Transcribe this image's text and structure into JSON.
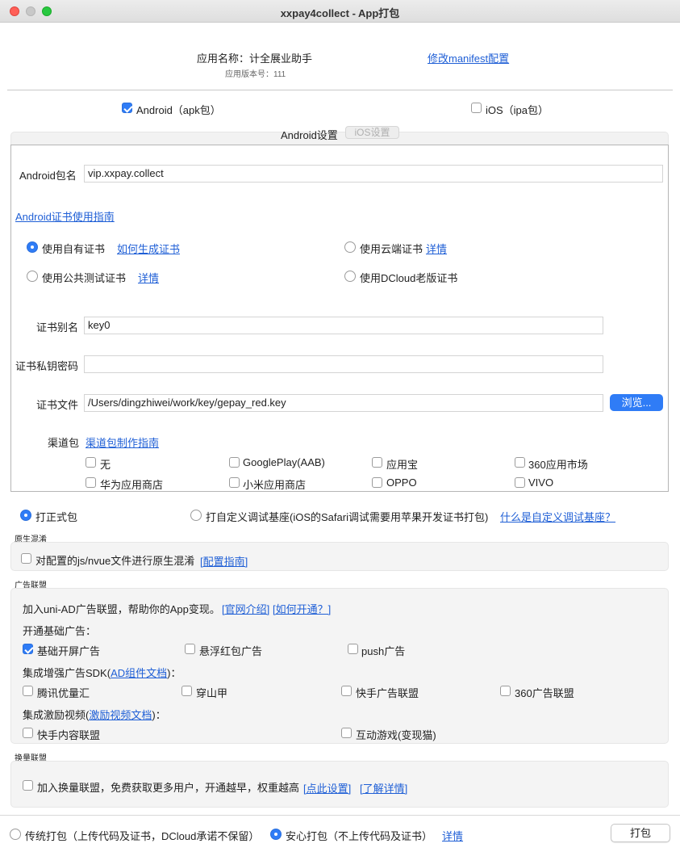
{
  "window": {
    "title": "xxpay4collect - App打包"
  },
  "header": {
    "app_name": "应用名称：计全展业助手",
    "app_version": "应用版本号：111",
    "edit_manifest": "修改manifest配置"
  },
  "platforms": {
    "android_label": "Android（apk包）",
    "android_checked": true,
    "ios_label": "iOS（ipa包）",
    "ios_checked": false
  },
  "tabs": [
    {
      "label": "Android设置",
      "active": true
    },
    {
      "label": "iOS设置",
      "active": false
    }
  ],
  "android": {
    "package_label": "Android包名",
    "package_value": "vip.xxpay.collect",
    "cert_guide": "Android证书使用指南",
    "cert_options": {
      "own": "使用自有证书",
      "own_link": "如何生成证书",
      "cloud": "使用云端证书",
      "cloud_link": "详情",
      "public_test": "使用公共测试证书",
      "public_link": "详情",
      "dcloud_old": "使用DCloud老版证书"
    },
    "alias_label": "证书别名",
    "alias_value": "key0",
    "password_label": "证书私钥密码",
    "password_value": "",
    "file_label": "证书文件",
    "file_value": "/Users/dingzhiwei/work/key/gepay_red.key",
    "browse": "浏览...",
    "channel_label": "渠道包",
    "channel_guide": "渠道包制作指南",
    "channels": [
      "无",
      "GooglePlay(AAB)",
      "应用宝",
      "360应用市场",
      "华为应用商店",
      "小米应用商店",
      "OPPO",
      "VIVO"
    ]
  },
  "build_type": {
    "formal": "打正式包",
    "custom": "打自定义调试基座(iOS的Safari调试需要用苹果开发证书打包)",
    "custom_link": "什么是自定义调试基座？"
  },
  "obfuscation": {
    "section": "原生混淆",
    "option": "对配置的js/nvue文件进行原生混淆",
    "link": "[配置指南]"
  },
  "ads": {
    "section": "广告联盟",
    "intro": "加入uni-AD广告联盟，帮助你的App变现。",
    "intro_link1": "[官网介绍]",
    "intro_link2": "[如何开通？]",
    "basic_title": "开通基础广告：",
    "basic": [
      "基础开屏广告",
      "悬浮红包广告",
      "push广告"
    ],
    "enhanced_title_prefix": "集成增强广告SDK(",
    "enhanced_link": "AD组件文档",
    "enhanced_title_suffix": ")：",
    "enhanced": [
      "腾讯优量汇",
      "穿山甲",
      "快手广告联盟",
      "360广告联盟"
    ],
    "reward_title_prefix": "集成激励视频(",
    "reward_link": "激励视频文档",
    "reward_title_suffix": ")：",
    "reward": [
      "快手内容联盟",
      "互动游戏(变现猫)"
    ]
  },
  "exchange": {
    "section": "换量联盟",
    "option": "加入换量联盟，免费获取更多用户，开通越早，权重越高",
    "link1": "[点此设置]",
    "link2": "[了解详情]"
  },
  "footer": {
    "traditional": "传统打包（上传代码及证书，DCloud承诺不保留）",
    "safe": "安心打包（不上传代码及证书）",
    "safe_link": "详情",
    "build": "打包"
  }
}
